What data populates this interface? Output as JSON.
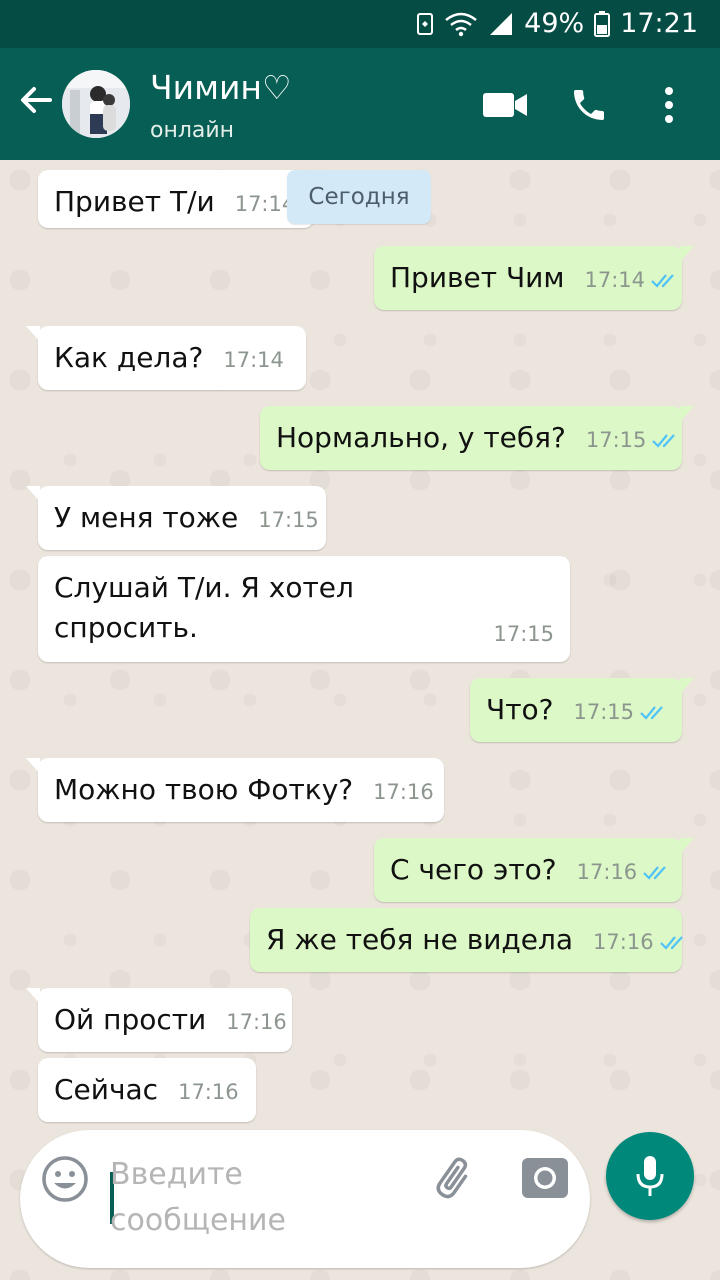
{
  "status_bar": {
    "battery": "49%",
    "time": "17:21"
  },
  "header": {
    "contact_name": "Чимин♡",
    "status": "онлайн"
  },
  "date_divider": "Сегодня",
  "messages": [
    {
      "text": "Привет Т/и",
      "time": "17:14"
    },
    {
      "text": "Привет Чим",
      "time": "17:14"
    },
    {
      "text": "Как дела?",
      "time": "17:14"
    },
    {
      "text": "Нормально, у тебя?",
      "time": "17:15"
    },
    {
      "text": "У меня тоже",
      "time": "17:15"
    },
    {
      "text_line1": "Слушай Т/и. Я хотел",
      "text_line2": "спросить.",
      "time": "17:15"
    },
    {
      "text": "Что?",
      "time": "17:15"
    },
    {
      "text": "Можно твою Фотку?",
      "time": "17:16"
    },
    {
      "text": "С чего это?",
      "time": "17:16"
    },
    {
      "text": "Я же тебя не видела",
      "time": "17:16"
    },
    {
      "text": "Ой прости",
      "time": "17:16"
    },
    {
      "text": "Сейчас",
      "time": "17:16"
    }
  ],
  "composer": {
    "placeholder": "Введите сообщение"
  },
  "colors": {
    "header": "#075e54",
    "status_bar": "#054d44",
    "outgoing": "#dcf8c6",
    "incoming": "#ffffff",
    "read_ticks": "#4fc3f7",
    "mic_button": "#00897b"
  },
  "icons": [
    "back-arrow-icon",
    "video-call-icon",
    "phone-icon",
    "more-vertical-icon",
    "emoji-icon",
    "attach-icon",
    "camera-icon",
    "mic-icon",
    "read-ticks-icon"
  ]
}
